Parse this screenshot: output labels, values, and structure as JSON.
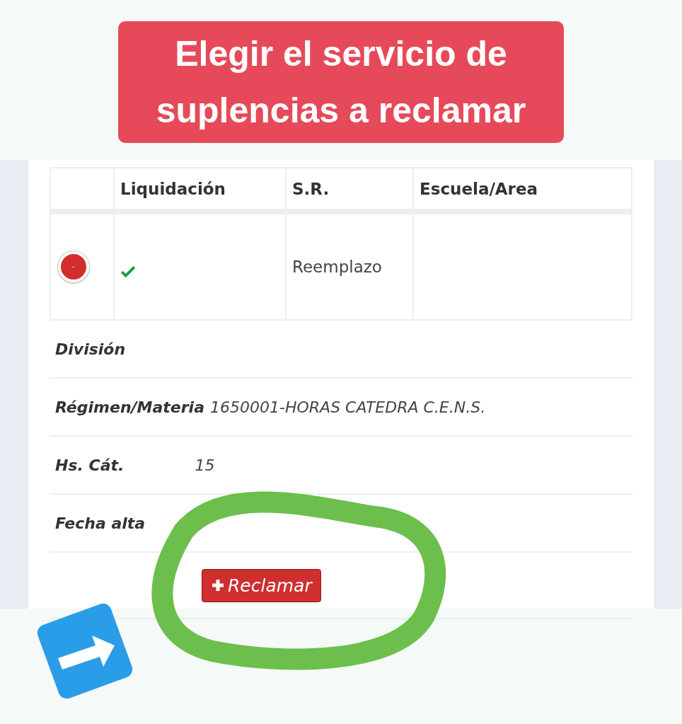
{
  "banner": {
    "text": "Elegir el servicio de suplencias a reclamar"
  },
  "table": {
    "columns": [
      "Liquidación",
      "S.R.",
      "Escuela/Area"
    ],
    "rows": [
      {
        "expanded": true,
        "paid": true,
        "sr": "Reemplazo"
      }
    ]
  },
  "details": [
    {
      "label": "División"
    },
    {
      "label": "Régimen/Materia",
      "value": "1650001-HORAS CATEDRA C.E.N.S.",
      "kind": "inline"
    },
    {
      "label": "Hs. Cát.",
      "value": "15",
      "kind": "tabbed"
    },
    {
      "label": "Fecha alta"
    }
  ],
  "action": {
    "label": "Reclamar"
  }
}
